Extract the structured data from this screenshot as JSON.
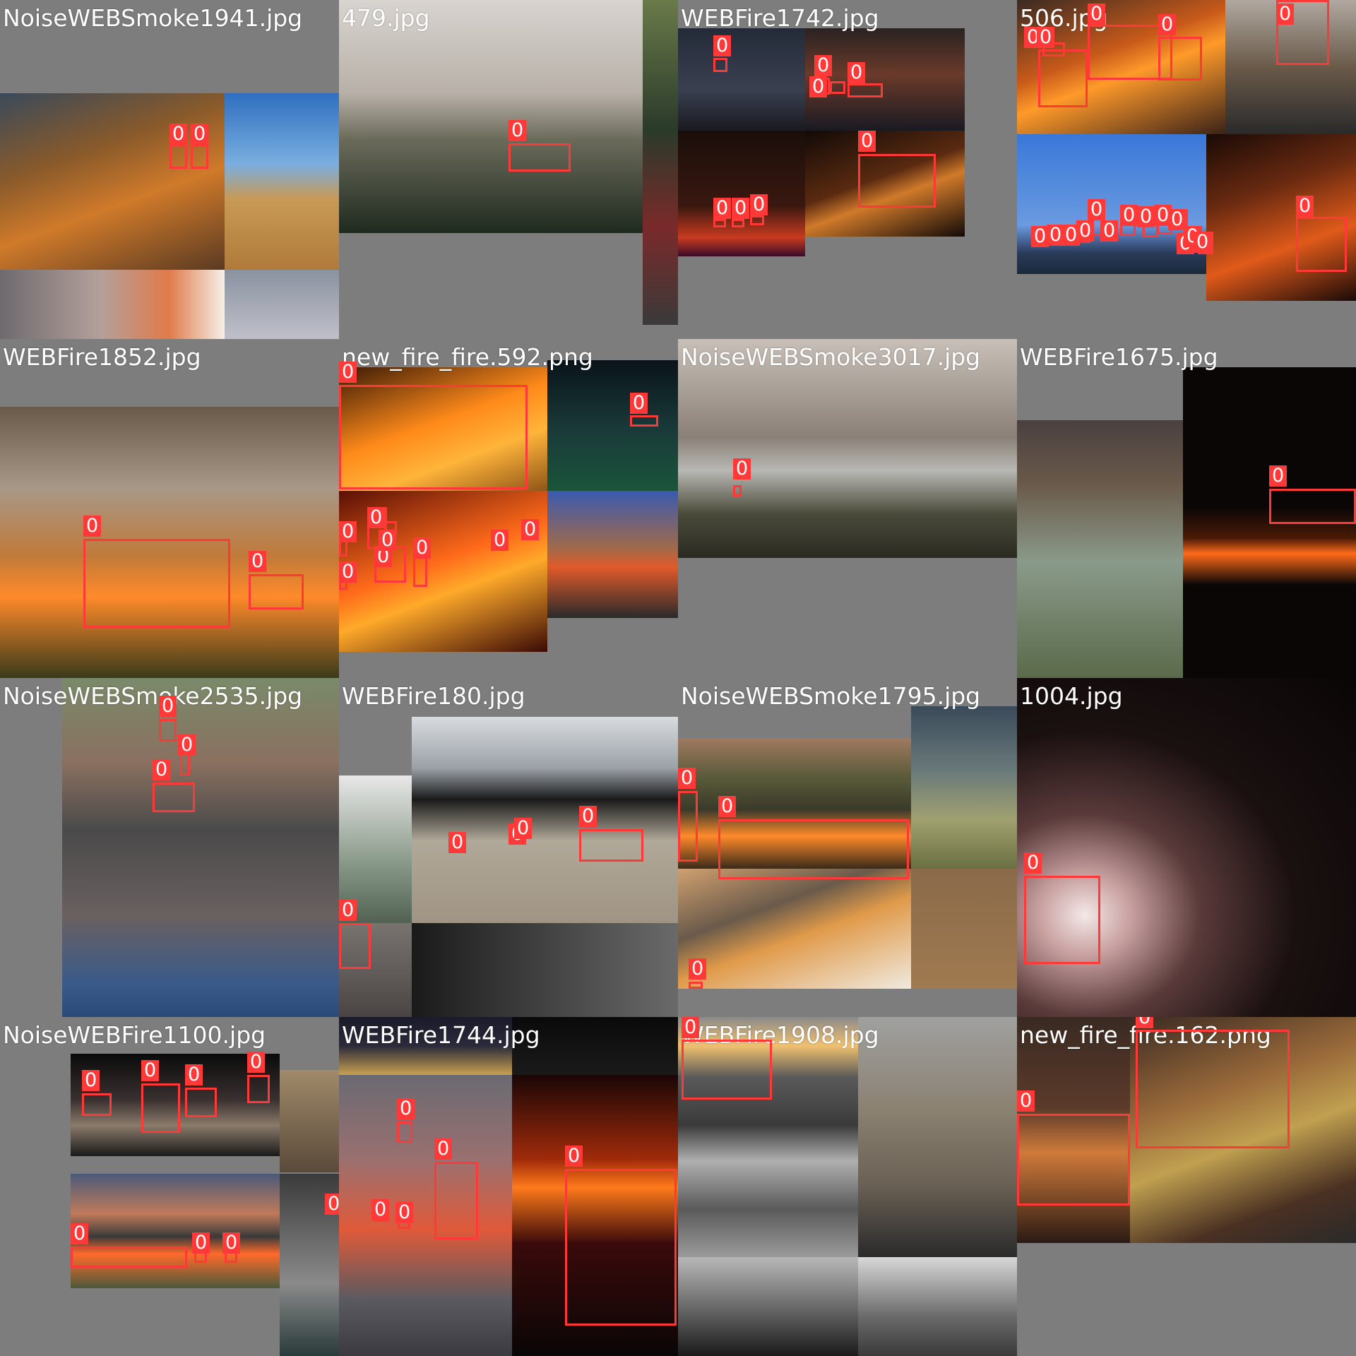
{
  "colors": {
    "box": "#ff3838",
    "label_text": "#ffffff",
    "tile_background": "#7d7d7d",
    "filename_text": "#ffffff"
  },
  "tiles": [
    {
      "filename": "NoiseWEBSmoke1941.jpg",
      "detections": [
        "0",
        "0"
      ]
    },
    {
      "filename": "479.jpg",
      "detections": [
        "0"
      ]
    },
    {
      "filename": "WEBFire1742.jpg",
      "detections": [
        "0",
        "0",
        "0",
        "0",
        "0",
        "0",
        "0",
        "0"
      ]
    },
    {
      "filename": "506.jpg",
      "detections": [
        "0",
        "0",
        "0",
        "0",
        "0",
        "0",
        "0",
        "0",
        "0",
        "0",
        "0",
        "0",
        "0",
        "0",
        "0",
        "0",
        "0",
        "0",
        "0"
      ]
    },
    {
      "filename": "WEBFire1852.jpg",
      "detections": [
        "0",
        "0"
      ]
    },
    {
      "filename": "new_fire_fire.592.png",
      "detections": [
        "0",
        "0",
        "0",
        "0",
        "0",
        "0",
        "0",
        "0",
        "0",
        "0"
      ]
    },
    {
      "filename": "NoiseWEBSmoke3017.jpg",
      "detections": [
        "0"
      ]
    },
    {
      "filename": "WEBFire1675.jpg",
      "detections": [
        "0"
      ]
    },
    {
      "filename": "NoiseWEBSmoke2535.jpg",
      "detections": [
        "0",
        "0",
        "0"
      ]
    },
    {
      "filename": "WEBFire180.jpg",
      "detections": [
        "0",
        "0",
        "0",
        "0",
        "0"
      ]
    },
    {
      "filename": "NoiseWEBSmoke1795.jpg",
      "detections": [
        "0",
        "0",
        "0"
      ]
    },
    {
      "filename": "1004.jpg",
      "detections": [
        "0"
      ]
    },
    {
      "filename": "NoiseWEBFire1100.jpg",
      "detections": [
        "0",
        "0",
        "0",
        "0",
        "0",
        "0",
        "0",
        "0"
      ]
    },
    {
      "filename": "WEBFire1744.jpg",
      "detections": [
        "0",
        "0",
        "0",
        "0",
        "0"
      ]
    },
    {
      "filename": "WEBFire1908.jpg",
      "detections": [
        "0"
      ]
    },
    {
      "filename": "new_fire_fire.162.png",
      "detections": [
        "0",
        "0"
      ]
    }
  ]
}
